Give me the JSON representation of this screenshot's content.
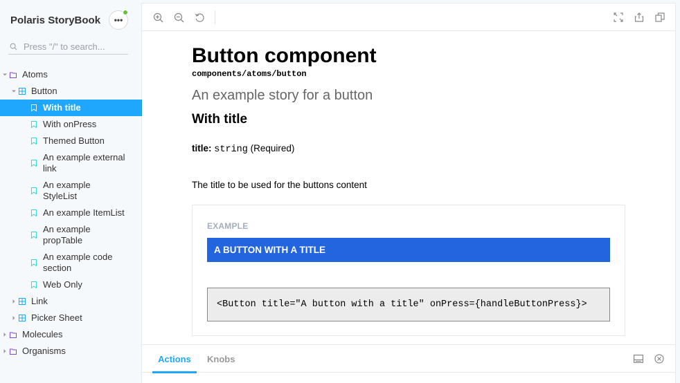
{
  "sidebar": {
    "brand": "Polaris StoryBook",
    "menu_label": "•••",
    "search_placeholder": "Press \"/\" to search...",
    "tree": [
      {
        "label": "Atoms",
        "kind": "folder",
        "depth": 0,
        "expanded": true
      },
      {
        "label": "Button",
        "kind": "component",
        "depth": 1,
        "expanded": true
      },
      {
        "label": "With title",
        "kind": "story",
        "depth": 2,
        "active": true
      },
      {
        "label": "With onPress",
        "kind": "story",
        "depth": 2
      },
      {
        "label": "Themed Button",
        "kind": "story",
        "depth": 2
      },
      {
        "label": "An example external link",
        "kind": "story",
        "depth": 2
      },
      {
        "label": "An example StyleList",
        "kind": "story",
        "depth": 2
      },
      {
        "label": "An example ItemList",
        "kind": "story",
        "depth": 2
      },
      {
        "label": "An example propTable",
        "kind": "story",
        "depth": 2
      },
      {
        "label": "An example code section",
        "kind": "story",
        "depth": 2
      },
      {
        "label": "Web Only",
        "kind": "story",
        "depth": 2
      },
      {
        "label": "Link",
        "kind": "component",
        "depth": 1,
        "expanded": false
      },
      {
        "label": "Picker Sheet",
        "kind": "component",
        "depth": 1,
        "expanded": false
      },
      {
        "label": "Molecules",
        "kind": "folder",
        "depth": 0,
        "expanded": false
      },
      {
        "label": "Organisms",
        "kind": "folder",
        "depth": 0,
        "expanded": false
      }
    ]
  },
  "toolbar": {
    "left_icons": [
      "zoom-in-icon",
      "zoom-out-icon",
      "zoom-reset-icon"
    ],
    "right_icons": [
      "fullscreen-icon",
      "share-icon",
      "copy-link-icon"
    ]
  },
  "docs": {
    "title": "Button component",
    "path": "components/atoms/button",
    "subtitle": "An example story for a button",
    "story_name": "With title",
    "prop": {
      "name": "title:",
      "type": "string",
      "required": "(Required)"
    },
    "prop_description": "The title to be used for the buttons content",
    "example_label": "EXAMPLE",
    "example_button_label": "A BUTTON WITH A TITLE",
    "code": "<Button title=\"A button with a title\" onPress={handleButtonPress}>"
  },
  "addons": {
    "tabs": [
      {
        "label": "Actions",
        "active": true
      },
      {
        "label": "Knobs",
        "active": false
      }
    ],
    "controls": [
      "panel-orientation-icon",
      "close-panel-icon"
    ]
  },
  "colors": {
    "accent": "#1ea7fd",
    "example_button": "#2265df",
    "status_dot": "#66bf3c",
    "folder_icon": "#774dd7",
    "component_icon": "#1ea7fd",
    "story_icon": "#37d5d3"
  }
}
